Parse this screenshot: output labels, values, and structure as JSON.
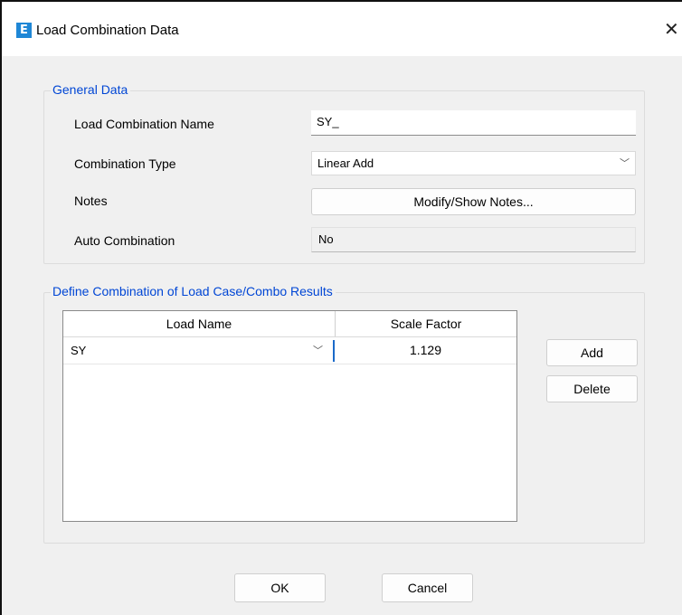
{
  "window": {
    "title": "Load Combination Data",
    "icon_letter": "E"
  },
  "general": {
    "legend": "General Data",
    "name_label": "Load Combination Name",
    "name_value": "SY_",
    "type_label": "Combination Type",
    "type_value": "Linear Add",
    "notes_label": "Notes",
    "notes_button": "Modify/Show Notes...",
    "auto_label": "Auto Combination",
    "auto_value": "No"
  },
  "define": {
    "legend": "Define Combination of Load Case/Combo Results",
    "columns": [
      "Load Name",
      "Scale Factor"
    ],
    "rows": [
      {
        "load": "SY",
        "scale": "1.129"
      }
    ],
    "add_button": "Add",
    "delete_button": "Delete"
  },
  "footer": {
    "ok": "OK",
    "cancel": "Cancel"
  },
  "icons": {
    "app": "etabs-app-icon",
    "close": "close-icon",
    "dropdown": "chevron-down-icon"
  },
  "colors": {
    "legend_text": "#0046d5",
    "app_icon": "#1f87d6",
    "dialog_bg": "#f0f0f0"
  }
}
